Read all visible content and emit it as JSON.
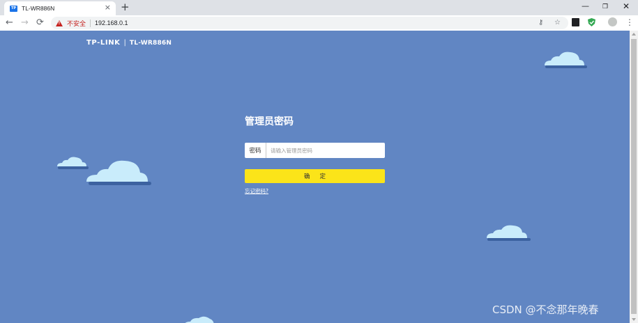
{
  "browser": {
    "tab_title": "TL-WR886N",
    "tab_favicon": "TP",
    "new_tab": "+",
    "window_controls": {
      "minimize": "—",
      "maximize": "❐",
      "close": "✕"
    },
    "security_label": "不安全",
    "url": "192.168.0.1",
    "icons": [
      "back-arrow-icon",
      "forward-arrow-icon",
      "reload-icon",
      "warning-icon",
      "key-icon",
      "star-icon",
      "extension-icon",
      "shield-icon",
      "profile-icon",
      "menu-icon"
    ]
  },
  "page": {
    "brand_logo": "TP-LINK",
    "brand_separator": "|",
    "brand_model": "TL-WR886N",
    "title": "管理员密码",
    "password_label": "密码",
    "password_placeholder": "请输入管理员密码",
    "confirm_label": "确定",
    "forgot_link": "忘记密码?",
    "watermark": "CSDN @不念那年晚春",
    "colors": {
      "background": "#6186c3",
      "confirm_button": "#fbe419",
      "cloud": "#c9ecfb",
      "cloud_shadow": "#3c62a0"
    }
  }
}
